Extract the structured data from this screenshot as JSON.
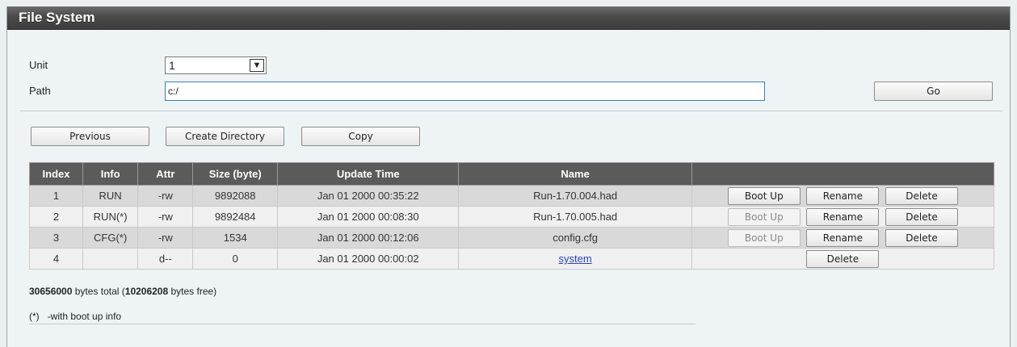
{
  "title": "File System",
  "form": {
    "unit_label": "Unit",
    "unit_value": "1",
    "path_label": "Path",
    "path_value": "c:/",
    "go_label": "Go"
  },
  "toolbar": {
    "previous_label": "Previous",
    "create_dir_label": "Create Directory",
    "copy_label": "Copy"
  },
  "table": {
    "headers": [
      "Index",
      "Info",
      "Attr",
      "Size (byte)",
      "Update Time",
      "Name"
    ],
    "rows": [
      {
        "index": "1",
        "info": "RUN",
        "attr": "-rw",
        "size": "9892088",
        "time": "Jan 01 2000 00:35:22",
        "name": "Run-1.70.004.had",
        "boot": "Boot Up",
        "rename": "Rename",
        "delete": "Delete"
      },
      {
        "index": "2",
        "info": "RUN(*)",
        "attr": "-rw",
        "size": "9892484",
        "time": "Jan 01 2000 00:08:30",
        "name": "Run-1.70.005.had",
        "boot": "Boot Up",
        "rename": "Rename",
        "delete": "Delete"
      },
      {
        "index": "3",
        "info": "CFG(*)",
        "attr": "-rw",
        "size": "1534",
        "time": "Jan 01 2000 00:12:06",
        "name": "config.cfg",
        "boot": "Boot Up",
        "rename": "Rename",
        "delete": "Delete"
      },
      {
        "index": "4",
        "info": "",
        "attr": "d--",
        "size": "0",
        "time": "Jan 01 2000 00:00:02",
        "name": "system",
        "delete": "Delete"
      }
    ]
  },
  "summary": {
    "total_bytes": "30656000",
    "text_mid": " bytes total (",
    "free_bytes": "10206208",
    "text_end": " bytes free)"
  },
  "legend": {
    "marker": "(*)",
    "text": "-with boot up info"
  }
}
